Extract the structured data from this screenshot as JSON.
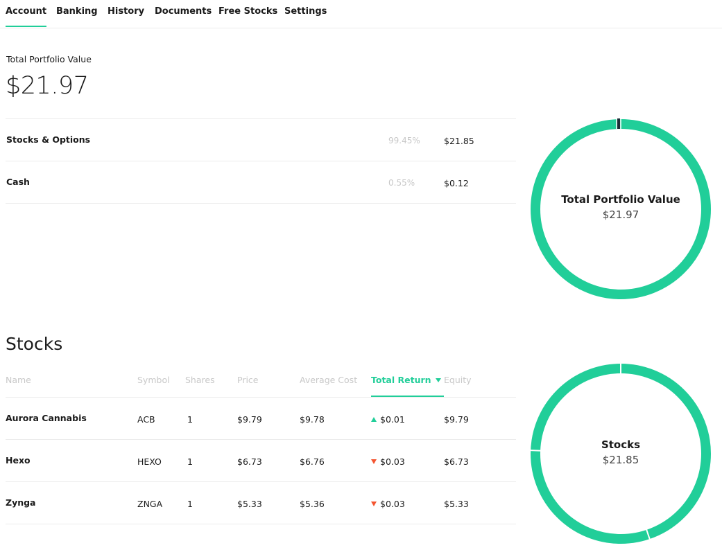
{
  "colors": {
    "accent": "#21ce99",
    "negative": "#f45531",
    "divider": "#ececec",
    "muted": "#c8c8c8",
    "donut_marker": "#1d2b36"
  },
  "nav": {
    "tabs": [
      {
        "label": "Account",
        "active": true
      },
      {
        "label": "Banking",
        "active": false
      },
      {
        "label": "History",
        "active": false
      },
      {
        "label": "Documents",
        "active": false
      },
      {
        "label": "Free Stocks",
        "active": false
      },
      {
        "label": "Settings",
        "active": false
      }
    ]
  },
  "portfolio": {
    "label": "Total Portfolio Value",
    "value": "$21.97",
    "allocations": [
      {
        "name": "Stocks & Options",
        "percent": "99.45%",
        "value": "$21.85"
      },
      {
        "name": "Cash",
        "percent": "0.55%",
        "value": "$0.12"
      }
    ],
    "donut": {
      "title": "Total Portfolio Value",
      "value": "$21.97",
      "segment_shares": [
        0.9945,
        0.0055
      ]
    }
  },
  "stocks": {
    "heading": "Stocks",
    "columns": {
      "name": "Name",
      "symbol": "Symbol",
      "shares": "Shares",
      "price": "Price",
      "average_cost": "Average Cost",
      "total_return": "Total Return",
      "equity": "Equity"
    },
    "sorted_column": "total_return",
    "rows": [
      {
        "name": "Aurora Cannabis",
        "symbol": "ACB",
        "shares": "1",
        "price": "$9.79",
        "average_cost": "$9.78",
        "total_return": "$0.01",
        "direction": "up",
        "equity": "$9.79"
      },
      {
        "name": "Hexo",
        "symbol": "HEXO",
        "shares": "1",
        "price": "$6.73",
        "average_cost": "$6.76",
        "total_return": "$0.03",
        "direction": "down",
        "equity": "$6.73"
      },
      {
        "name": "Zynga",
        "symbol": "ZNGA",
        "shares": "1",
        "price": "$5.33",
        "average_cost": "$5.36",
        "total_return": "$0.03",
        "direction": "down",
        "equity": "$5.33"
      }
    ],
    "donut": {
      "title": "Stocks",
      "value": "$21.85",
      "segment_shares": [
        0.448,
        0.308,
        0.244
      ]
    }
  }
}
